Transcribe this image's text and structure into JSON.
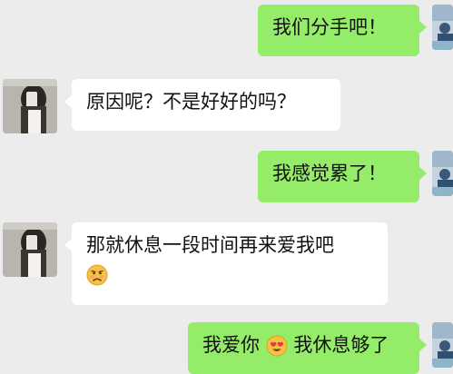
{
  "messages": [
    {
      "side": "right",
      "text": "我们分手吧！"
    },
    {
      "side": "left",
      "text": "原因呢？不是好好的吗？"
    },
    {
      "side": "right",
      "text": "我感觉累了！"
    },
    {
      "side": "left",
      "text": "那就休息一段时间再来爱我吧",
      "emoji": "sad-face-icon"
    },
    {
      "side": "right",
      "text_before": "我爱你",
      "emoji": "heart-eyes-icon",
      "text_after": "我休息够了"
    }
  ],
  "colors": {
    "background": "#ececec",
    "sent_bubble": "#95ec69",
    "received_bubble": "#ffffff"
  }
}
